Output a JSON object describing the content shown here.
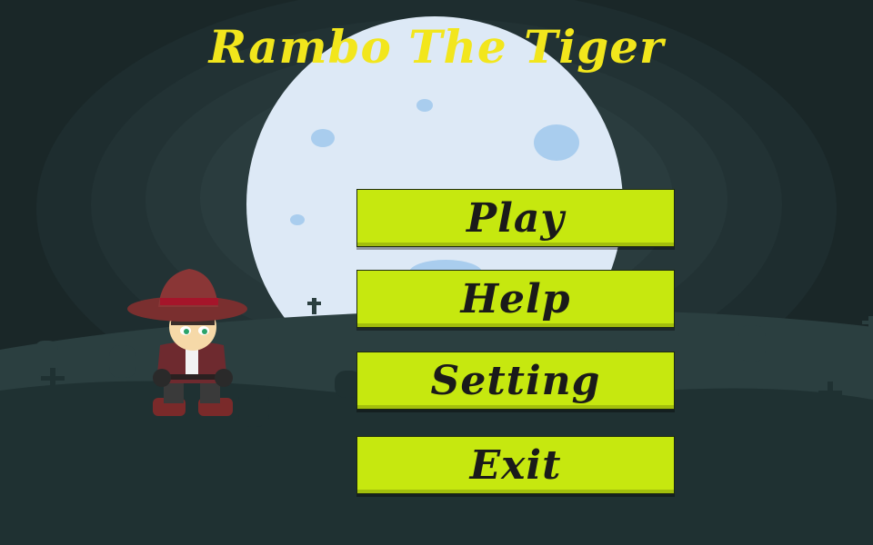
{
  "game": {
    "title": "Rambo The Tiger",
    "title_color": "#f2e61c"
  },
  "menu": {
    "buttons": [
      {
        "id": "play",
        "label": "Play"
      },
      {
        "id": "help",
        "label": "Help"
      },
      {
        "id": "setting",
        "label": "Setting"
      },
      {
        "id": "exit",
        "label": "Exit"
      }
    ],
    "button_color": "#c6e80f"
  },
  "scene": {
    "sky_color": "#1c2a2b",
    "moon_color": "#dde9f6",
    "ground_color": "#1f3132",
    "character": "cowboy-hero"
  }
}
